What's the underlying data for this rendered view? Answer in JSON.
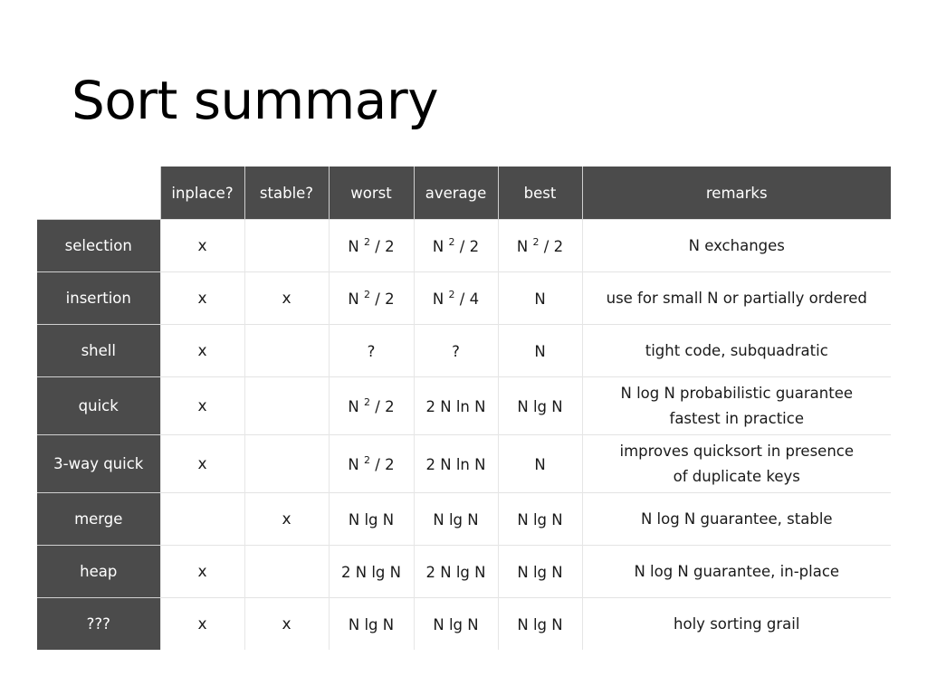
{
  "title": "Sort summary",
  "table": {
    "columns": [
      "inplace?",
      "stable?",
      "worst",
      "average",
      "best",
      "remarks"
    ],
    "rows": [
      {
        "name": "selection",
        "inplace": "x",
        "stable": "",
        "worst": "N 2 / 2",
        "worst_parts": [
          "N",
          "2",
          "/ 2"
        ],
        "average_parts": [
          "N",
          "2",
          "/ 2"
        ],
        "best_parts": [
          "N",
          "2",
          "/ 2"
        ],
        "average": "N 2 / 2",
        "best": "N 2 / 2",
        "remarks": [
          "N exchanges"
        ]
      },
      {
        "name": "insertion",
        "inplace": "x",
        "stable": "x",
        "worst": "N 2 / 2",
        "worst_parts": [
          "N",
          "2",
          "/ 2"
        ],
        "average_parts": [
          "N",
          "2",
          "/ 4"
        ],
        "best_parts": [
          "N",
          "",
          ""
        ],
        "average": "N 2 / 4",
        "best": "N",
        "remarks": [
          "use for small N or partially ordered"
        ]
      },
      {
        "name": "shell",
        "inplace": "x",
        "stable": "",
        "worst": "?",
        "worst_parts": [
          "?",
          "",
          ""
        ],
        "average_parts": [
          "?",
          "",
          ""
        ],
        "best_parts": [
          "N",
          "",
          ""
        ],
        "average": "?",
        "best": "N",
        "remarks": [
          "tight code, subquadratic"
        ]
      },
      {
        "name": "quick",
        "inplace": "x",
        "stable": "",
        "worst": "N 2 / 2",
        "worst_parts": [
          "N",
          "2",
          "/ 2"
        ],
        "average_parts": [
          "2 N ln N",
          "",
          ""
        ],
        "best_parts": [
          "N lg N",
          "",
          ""
        ],
        "average": "2 N ln N",
        "best": "N lg N",
        "remarks": [
          "N log N  probabilistic guarantee",
          "fastest in practice"
        ]
      },
      {
        "name": "3-way quick",
        "inplace": "x",
        "stable": "",
        "worst": "N 2 / 2",
        "worst_parts": [
          "N",
          "2",
          "/ 2"
        ],
        "average_parts": [
          "2 N ln N",
          "",
          ""
        ],
        "best_parts": [
          "N",
          "",
          ""
        ],
        "average": "2 N ln N",
        "best": "N",
        "remarks": [
          "improves quicksort in presence",
          "of duplicate keys"
        ]
      },
      {
        "name": "merge",
        "inplace": "",
        "stable": "x",
        "worst": "N lg N",
        "worst_parts": [
          "N lg N",
          "",
          ""
        ],
        "average_parts": [
          "N lg N",
          "",
          ""
        ],
        "best_parts": [
          "N lg N",
          "",
          ""
        ],
        "average": "N lg N",
        "best": "N lg N",
        "remarks": [
          "N log N  guarantee, stable"
        ]
      },
      {
        "name": "heap",
        "inplace": "x",
        "stable": "",
        "worst": "2 N lg N",
        "worst_parts": [
          "2 N lg N",
          "",
          ""
        ],
        "average_parts": [
          "2 N lg N",
          "",
          ""
        ],
        "best_parts": [
          "N lg N",
          "",
          ""
        ],
        "average": "2 N lg N",
        "best": "N lg N",
        "remarks": [
          "N log N  guarantee, in-place"
        ]
      },
      {
        "name": "???",
        "inplace": "x",
        "stable": "x",
        "worst": "N lg N",
        "worst_parts": [
          "N lg N",
          "",
          ""
        ],
        "average_parts": [
          "N lg N",
          "",
          ""
        ],
        "best_parts": [
          "N lg N",
          "",
          ""
        ],
        "average": "N lg N",
        "best": "N lg N",
        "remarks": [
          "holy sorting grail"
        ]
      }
    ]
  },
  "colors": {
    "header_bg": "#4b4b4b",
    "header_text": "#ffffff",
    "grid": "#e3e3e3"
  }
}
